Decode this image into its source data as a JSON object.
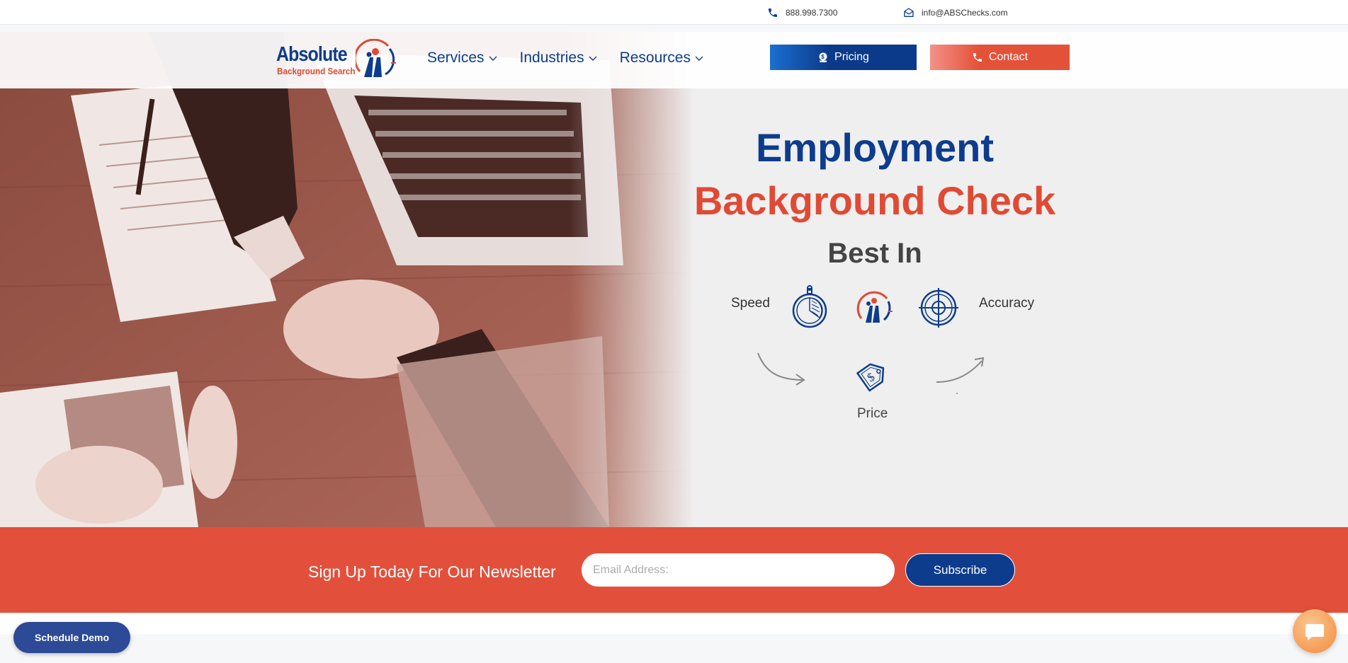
{
  "topbar": {
    "phone": "888.998.7300",
    "email": "info@ABSChecks.com"
  },
  "logo": {
    "word1": "Absolute",
    "word2": "Background Search"
  },
  "nav": {
    "items": [
      {
        "label": "Services"
      },
      {
        "label": "Industries"
      },
      {
        "label": "Resources"
      }
    ],
    "pricing_label": "Pricing",
    "contact_label": "Contact"
  },
  "hero": {
    "line1": "Employment",
    "line2": "Background Check",
    "line3": "Best In",
    "speed": "Speed",
    "accuracy": "Accuracy",
    "price": "Price"
  },
  "newsletter": {
    "title": "Sign Up Today For Our Newsletter",
    "placeholder": "Email Address:",
    "subscribe_label": "Subscribe"
  },
  "demo_label": "Schedule Demo",
  "colors": {
    "brand_blue": "#0d3c8c",
    "brand_red": "#e04a34",
    "newsletter_bg": "#e2503b",
    "chat_orange": "#f38a3e"
  },
  "icons": [
    "phone-icon",
    "mail-icon",
    "chevron-down-icon",
    "price-tag-icon",
    "stopwatch-icon",
    "target-icon",
    "chat-icon"
  ]
}
